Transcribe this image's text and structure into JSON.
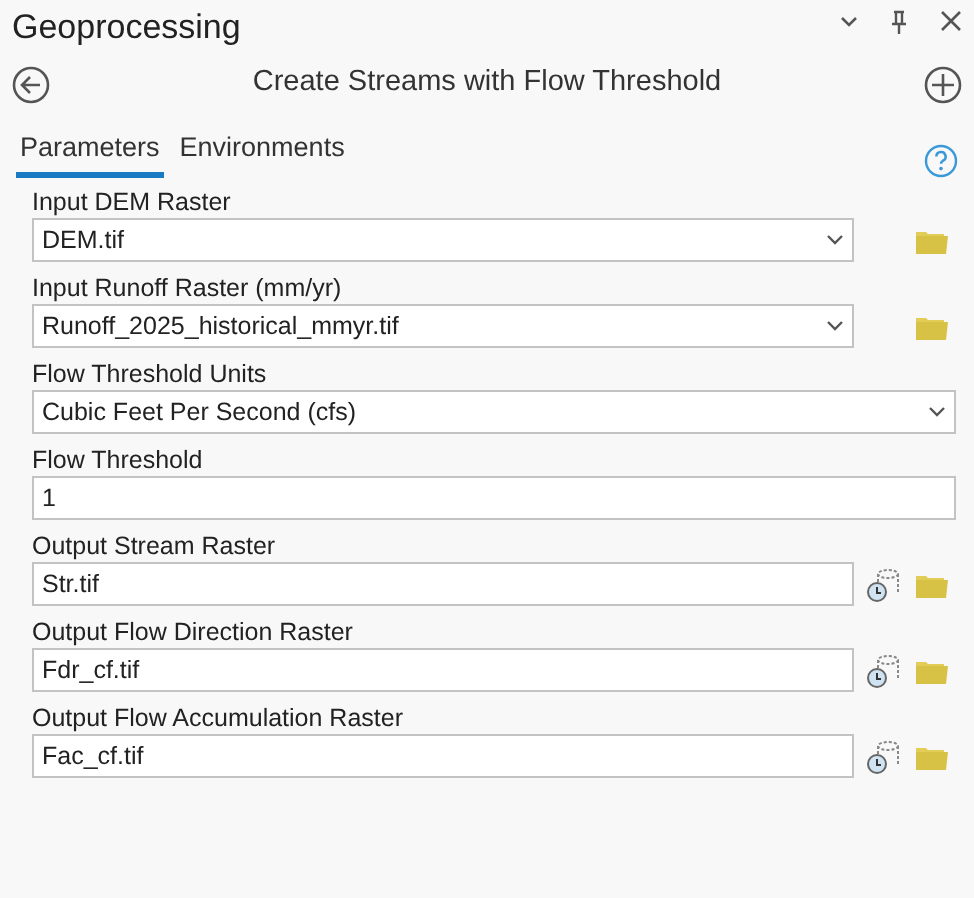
{
  "pane": {
    "title": "Geoprocessing"
  },
  "tool": {
    "title": "Create Streams with Flow Threshold"
  },
  "tabs": [
    {
      "label": "Parameters",
      "selected": true
    },
    {
      "label": "Environments",
      "selected": false
    }
  ],
  "parameters": [
    {
      "kind": "input-dropdown",
      "label": "Input DEM Raster",
      "value": "DEM.tif"
    },
    {
      "kind": "input-dropdown",
      "label": "Input Runoff Raster (mm/yr)",
      "value": "Runoff_2025_historical_mmyr.tif"
    },
    {
      "kind": "dropdown",
      "label": "Flow Threshold Units",
      "value": "Cubic Feet Per Second (cfs)"
    },
    {
      "kind": "text",
      "label": "Flow Threshold",
      "value": "1"
    },
    {
      "kind": "output",
      "label": "Output Stream Raster",
      "value": "Str.tif"
    },
    {
      "kind": "output",
      "label": "Output Flow Direction Raster",
      "value": "Fdr_cf.tif"
    },
    {
      "kind": "output",
      "label": "Output Flow Accumulation Raster",
      "value": "Fac_cf.tif"
    }
  ]
}
